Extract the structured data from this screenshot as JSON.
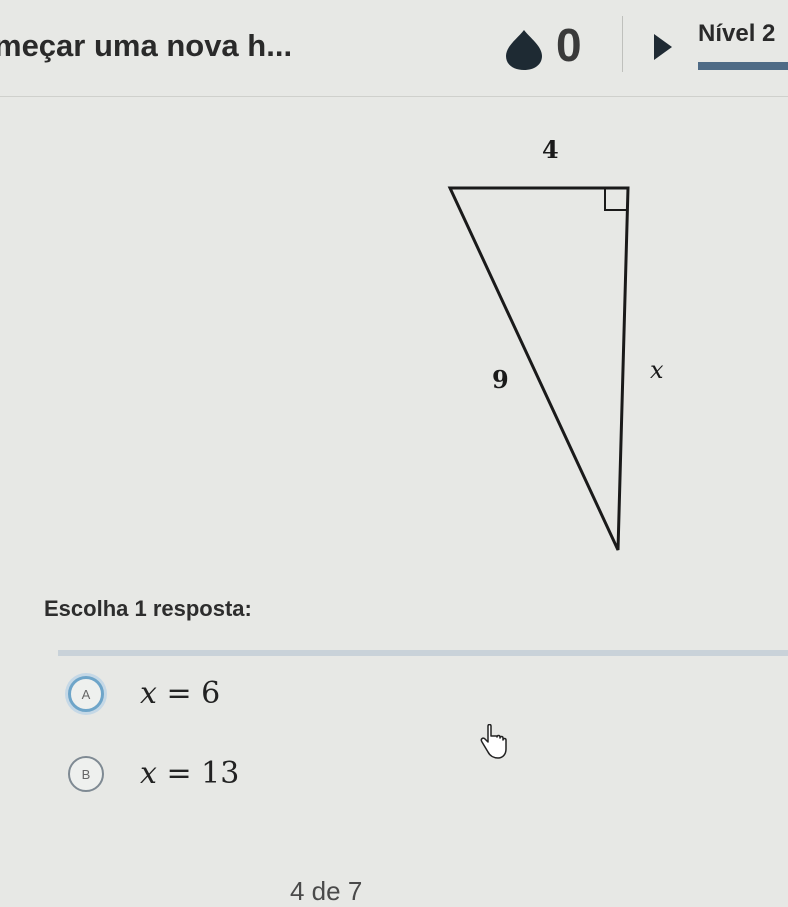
{
  "header": {
    "title": "meçar uma nova h...",
    "streak_count": "0",
    "level_label": "Nível 2",
    "level_progress": 1.0
  },
  "figure": {
    "top_label": "4",
    "hypotenuse_label": "9",
    "right_label": "x"
  },
  "question": {
    "prompt": "Escolha 1 resposta:",
    "options": [
      {
        "letter": "A",
        "variable": "x",
        "relation": "=",
        "value": "6",
        "selected": true
      },
      {
        "letter": "B",
        "variable": "x",
        "relation": "=",
        "value": "13",
        "selected": false
      }
    ]
  },
  "footer": {
    "pager": "4 de 7"
  },
  "colors": {
    "background": "#e7e8e5",
    "accent": "#4f6b86",
    "selected_ring": "#6ea5c9"
  },
  "icons": {
    "gem": "drop-gem-icon",
    "play": "play-triangle-icon",
    "cursor": "hand-pointer-icon"
  }
}
